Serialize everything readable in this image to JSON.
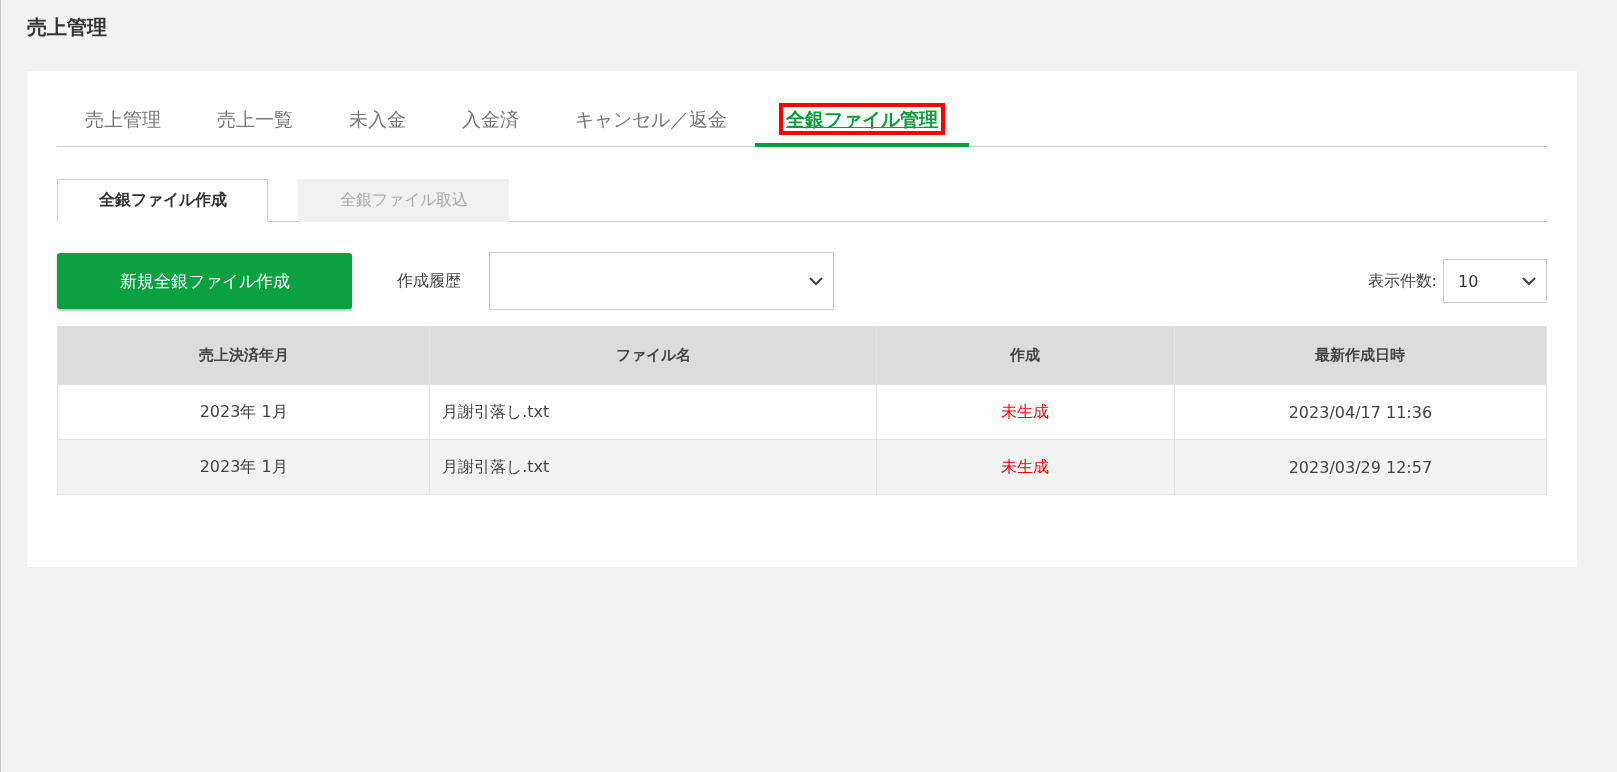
{
  "page_title": "売上管理",
  "tabs": [
    {
      "label": "売上管理",
      "selected": false,
      "highlighted": false
    },
    {
      "label": "売上一覧",
      "selected": false,
      "highlighted": false
    },
    {
      "label": "未入金",
      "selected": false,
      "highlighted": false
    },
    {
      "label": "入金済",
      "selected": false,
      "highlighted": false
    },
    {
      "label": "キャンセル／返金",
      "selected": false,
      "highlighted": false
    },
    {
      "label": "全銀ファイル管理",
      "selected": true,
      "highlighted": true
    }
  ],
  "subtabs": [
    {
      "label": "全銀ファイル作成",
      "selected": true
    },
    {
      "label": "全銀ファイル取込",
      "selected": false
    }
  ],
  "create_button": "新規全銀ファイル作成",
  "history": {
    "label": "作成履歴"
  },
  "page_size": {
    "label": "表示件数:",
    "value": "10"
  },
  "table": {
    "columns": [
      "売上決済年月",
      "ファイル名",
      "作成",
      "最新作成日時"
    ],
    "rows": [
      {
        "month": "2023年 1月",
        "file": "月謝引落し.txt",
        "status": "未生成",
        "color": "#ff0000",
        "updated": "2023/04/17 11:36"
      },
      {
        "month": "2023年 1月",
        "file": "月謝引落し.txt",
        "status": "未生成",
        "color": "#ff0000",
        "updated": "2023/03/29 12:57"
      }
    ]
  }
}
